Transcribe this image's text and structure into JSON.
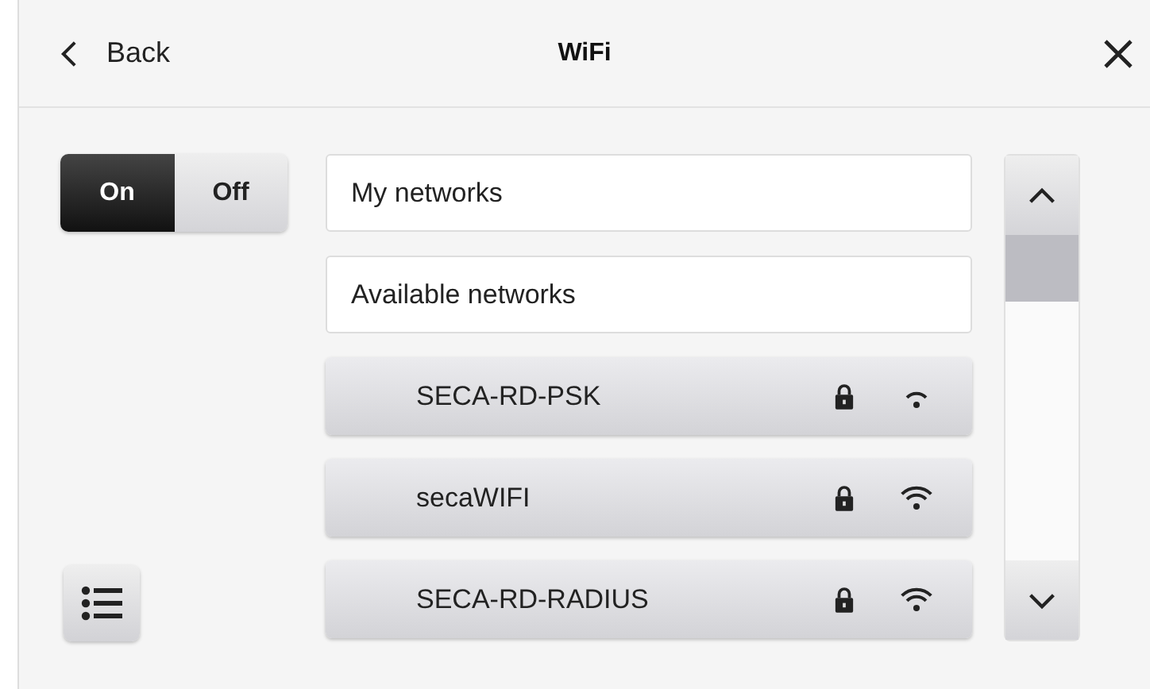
{
  "header": {
    "back_label": "Back",
    "title": "WiFi"
  },
  "power_toggle": [
    {
      "label": "On",
      "selected": true
    },
    {
      "label": "Off",
      "selected": false
    }
  ],
  "sections": [
    {
      "label": "My networks"
    },
    {
      "label": "Available networks"
    }
  ],
  "networks": [
    {
      "name": "SECA-RD-PSK",
      "secured": true,
      "kind": "weak"
    },
    {
      "name": "secaWIFI",
      "secured": true,
      "kind": "full"
    },
    {
      "name": "SECA-RD-RADIUS",
      "secured": true,
      "kind": "full"
    }
  ]
}
